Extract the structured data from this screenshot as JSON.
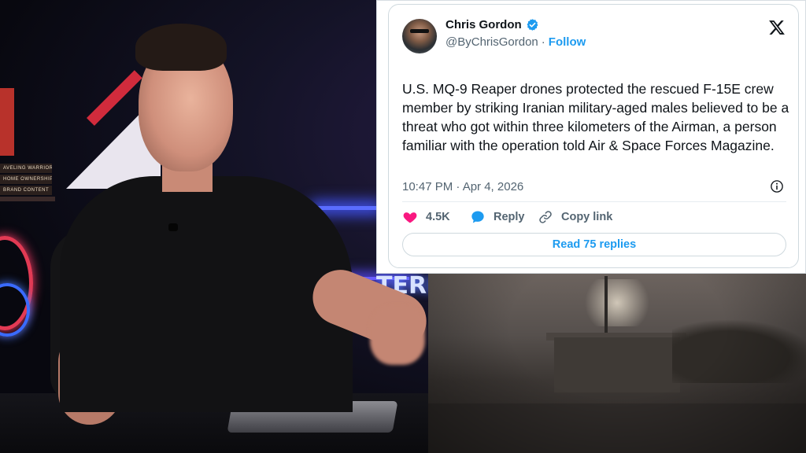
{
  "studio_video": {
    "books": [
      "AVELING WARRIORS",
      "HOME OWNERSHIP",
      "BRAND CONTENT"
    ],
    "neon_sign_text": "TERP"
  },
  "tweet": {
    "display_name": "Chris Gordon",
    "verified": true,
    "handle": "@ByChrisGordon",
    "separator": "·",
    "follow_label": "Follow",
    "platform_icon": "x-logo-icon",
    "text": "U.S. MQ-9 Reaper drones protected the rescued F-15E crew member by striking Iranian military-aged males believed to be a threat who got within three kilometers of the Airman, a person familiar with the operation told Air & Space Forces Magazine.",
    "timestamp": "10:47 PM · Apr 4, 2026",
    "like_count": "4.5K",
    "reply_label": "Reply",
    "copy_link_label": "Copy link",
    "read_replies_label": "Read 75 replies",
    "colors": {
      "accent": "#1d9bf0",
      "like": "#f91880",
      "text": "#0f1419",
      "muted": "#536471"
    }
  }
}
